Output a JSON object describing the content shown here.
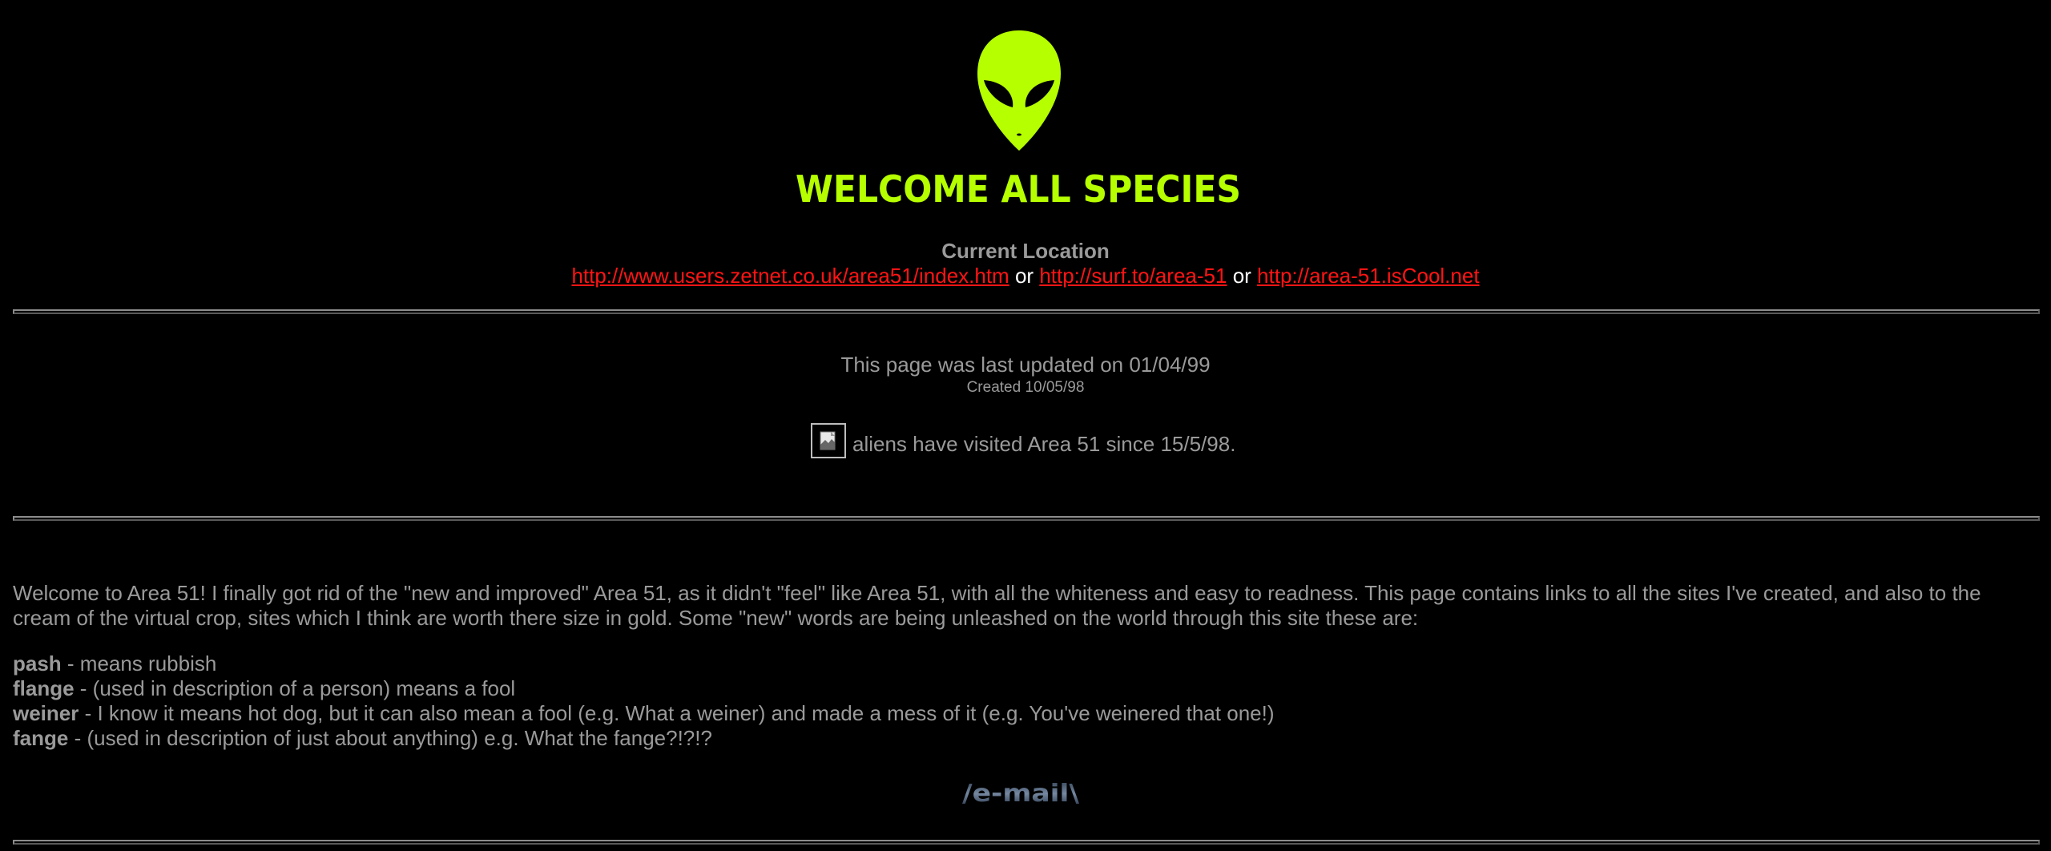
{
  "header": {
    "banner_text": "WELCOME ALL SPECIES",
    "location_heading": "Current Location",
    "links": [
      "http://www.users.zetnet.co.uk/area51/index.htm",
      "http://surf.to/area-51",
      "http://area-51.isCool.net"
    ],
    "separator": "or"
  },
  "updates": {
    "last_updated": "This page was last updated on 01/04/99",
    "created": "Created 10/05/98",
    "visitor_text": "aliens have visited Area 51 since 15/5/98."
  },
  "intro": {
    "text": "Welcome to Area 51! I finally got rid of the \"new and improved\" Area 51, as it didn't \"feel\" like Area 51, with all the whiteness and easy to readness. This page contains links to all the sites I've created, and also to the cream of the virtual crop, sites which I think are worth there size in gold. Some \"new\" words are being unleashed on the world through this site these are:"
  },
  "glossary": [
    {
      "term": "pash",
      "definition": " - means rubbish"
    },
    {
      "term": "flange",
      "definition": " - (used in description of a person) means a fool"
    },
    {
      "term": "weiner",
      "definition": " - I know it means hot dog, but it can also mean a fool (e.g. What a weiner) and made a mess of it (e.g. You've weinered that one!)"
    },
    {
      "term": "fange",
      "definition": " - (used in description of just about anything) e.g. What the fange?!?!?"
    }
  ],
  "email": {
    "label": "/e-mail\\"
  },
  "colors": {
    "background": "#000000",
    "text": "#9a9a9a",
    "link": "#ff1414",
    "alien_green": "#b6ff00"
  },
  "icons": {
    "logo": "alien-head-icon",
    "counter": "broken-image-icon"
  }
}
